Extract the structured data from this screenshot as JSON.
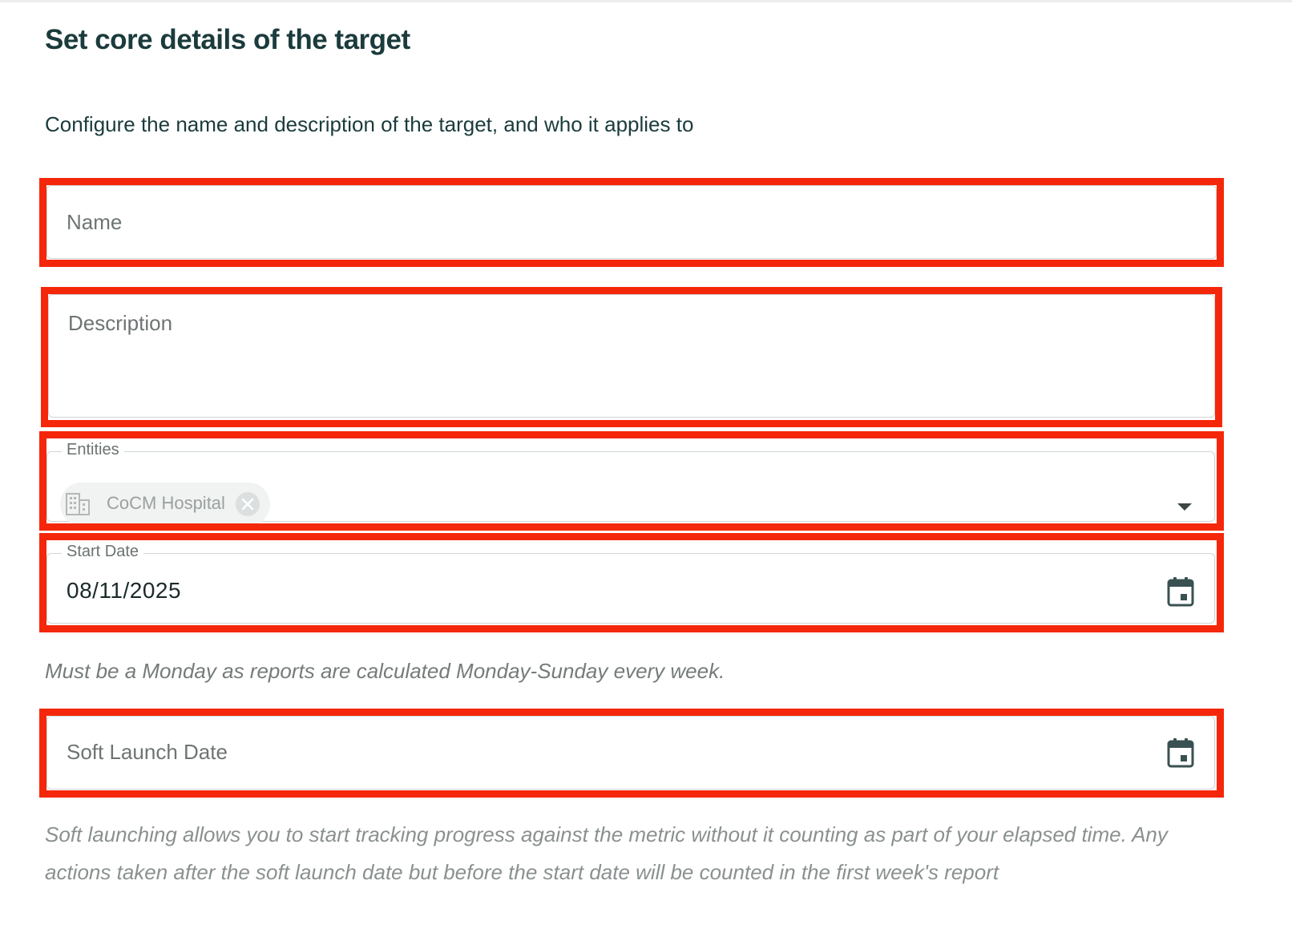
{
  "section": {
    "title": "Set core details of the target",
    "subtitle": "Configure the name and description of the target, and who it applies to"
  },
  "fields": {
    "name": {
      "placeholder": "Name",
      "value": ""
    },
    "description": {
      "placeholder": "Description",
      "value": ""
    },
    "entities": {
      "label": "Entities",
      "chips": [
        {
          "label": "CoCM Hospital",
          "icon": "building-icon"
        }
      ],
      "dropdown_icon": "arrow-drop-down-icon"
    },
    "start_date": {
      "label": "Start Date",
      "value": "08/11/2025",
      "icon": "calendar-icon",
      "helper": "Must be a Monday as reports are calculated Monday-Sunday every week."
    },
    "soft_launch_date": {
      "placeholder": "Soft Launch Date",
      "value": "",
      "icon": "calendar-icon",
      "helper": "Soft launching allows you to start tracking progress against the metric without it counting as part of your elapsed time. Any actions taken after the soft launch date but before the start date will be counted in the first week's report"
    }
  },
  "colors": {
    "highlight": "#f5270b",
    "heading": "#1b3b3c",
    "placeholder": "#6e7474",
    "helper": "#757b7b"
  }
}
